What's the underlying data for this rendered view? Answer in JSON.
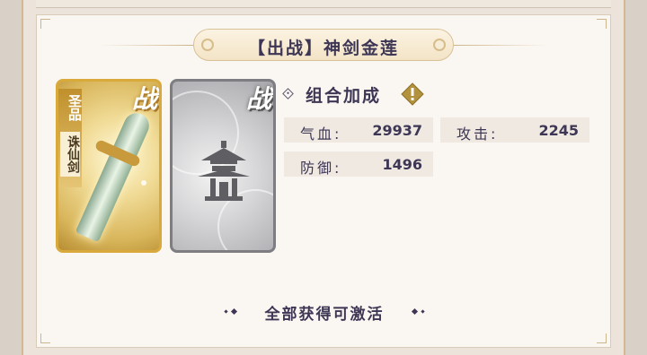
{
  "header": {
    "title": "【出战】神剑金莲"
  },
  "cards": [
    {
      "rarity_tag": "圣品",
      "name": "诛仙剑",
      "badge": "战",
      "state": "owned",
      "color": "#d9a93c"
    },
    {
      "badge": "战",
      "state": "locked",
      "icon": "pagoda-icon",
      "color": "#7d7d82"
    }
  ],
  "bonus": {
    "title": "组合加成",
    "icon": "warning-icon",
    "stats": [
      {
        "label": "气血:",
        "value": "29937"
      },
      {
        "label": "攻击:",
        "value": "2245"
      },
      {
        "label": "防御:",
        "value": "1496"
      }
    ]
  },
  "footer": {
    "hint": "全部获得可激活"
  },
  "colors": {
    "text": "#3d3654",
    "gold": "#d9a93c",
    "stat_bg": "#efe9e2"
  }
}
